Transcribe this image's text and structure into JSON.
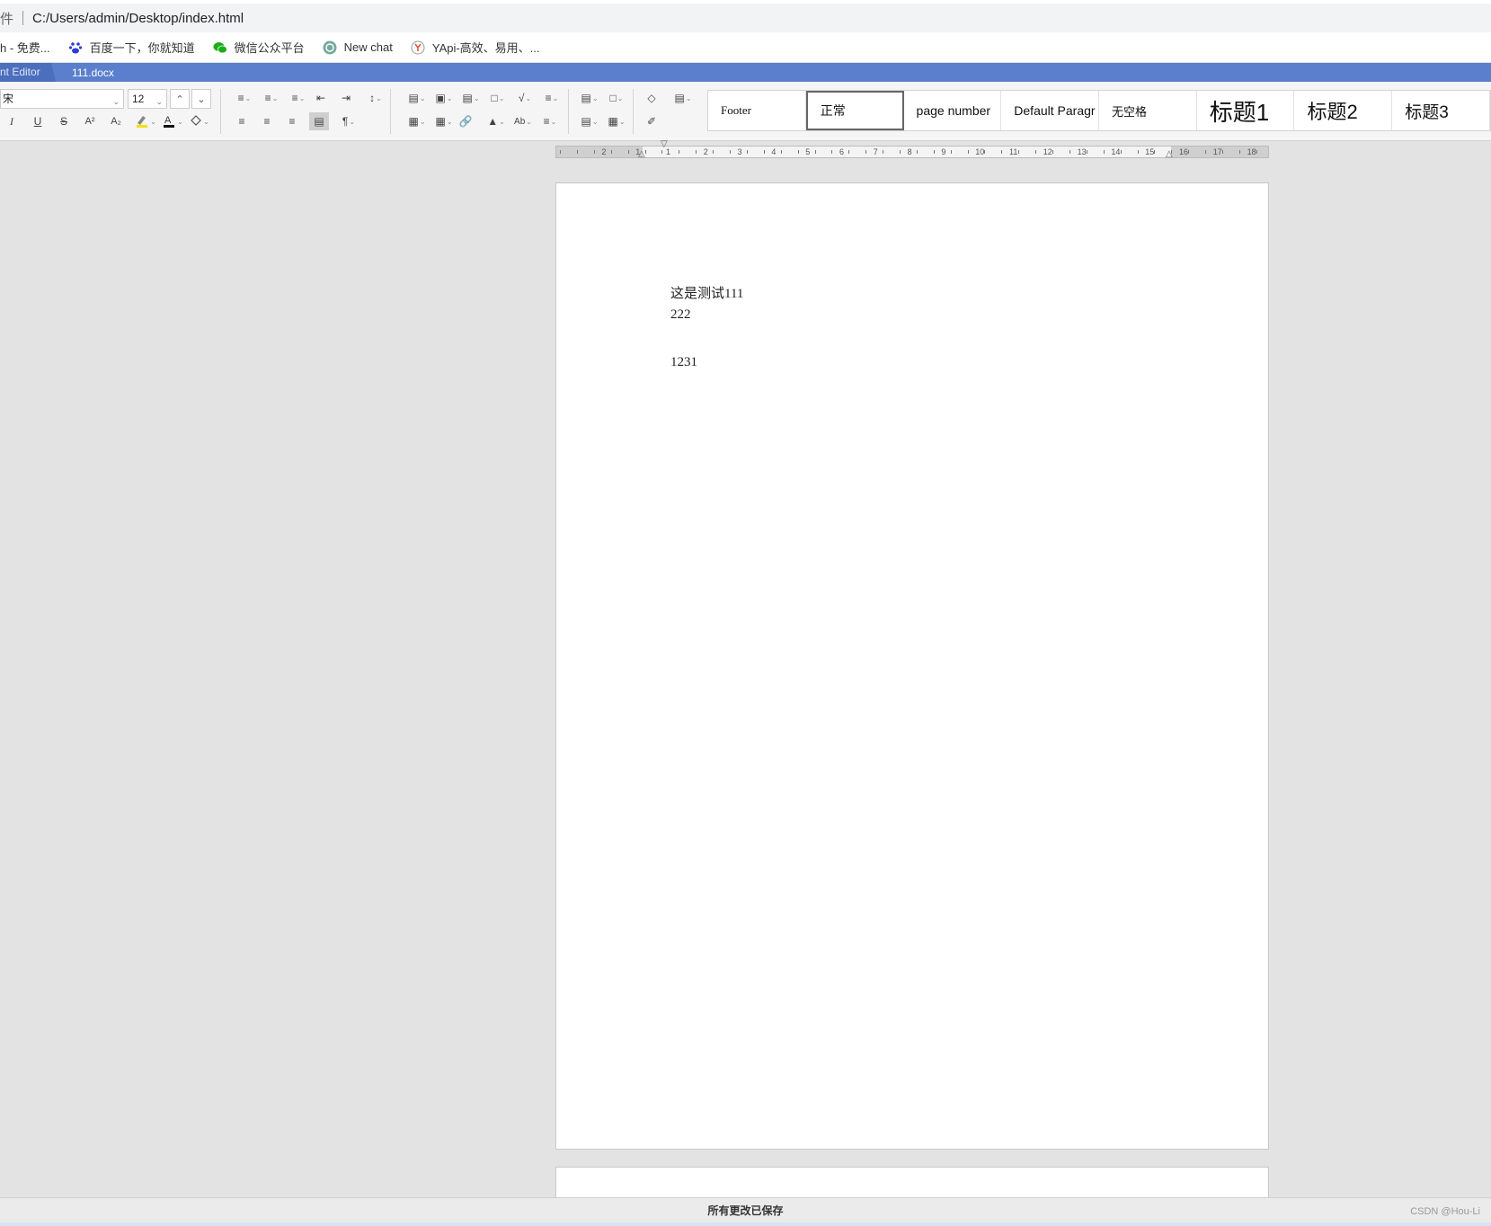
{
  "browser": {
    "address_prefix": "件",
    "url": "C:/Users/admin/Desktop/index.html"
  },
  "bookmarks": [
    {
      "label": "h - 免费...",
      "icon": ""
    },
    {
      "label": "百度一下，你就知道",
      "icon": "baidu-paw-icon"
    },
    {
      "label": "微信公众平台",
      "icon": "wechat-icon"
    },
    {
      "label": "New chat",
      "icon": "openai-icon"
    },
    {
      "label": "YApi-高效、易用、...",
      "icon": "yapi-icon"
    }
  ],
  "tabs": {
    "app": "nt Editor",
    "document": "111.docx"
  },
  "toolbar": {
    "font_name": "宋",
    "font_size": "12",
    "accent": "#5b7fcc"
  },
  "styles": [
    {
      "label": "Footer"
    },
    {
      "label": "正常"
    },
    {
      "label": "page number"
    },
    {
      "label": "Default Paragr"
    },
    {
      "label": "无空格"
    },
    {
      "label": "标题1"
    },
    {
      "label": "标题2"
    },
    {
      "label": "标题3"
    }
  ],
  "ruler": {
    "labels": [
      "2",
      "1",
      "1",
      "2",
      "3",
      "4",
      "5",
      "6",
      "7",
      "8",
      "9",
      "10",
      "11",
      "12",
      "13",
      "14",
      "15",
      "16",
      "17",
      "18"
    ]
  },
  "document": {
    "lines": [
      "这是测试111",
      "222",
      "1231"
    ]
  },
  "status": {
    "message": "所有更改已保存",
    "watermark": "CSDN @Hou-Li"
  }
}
